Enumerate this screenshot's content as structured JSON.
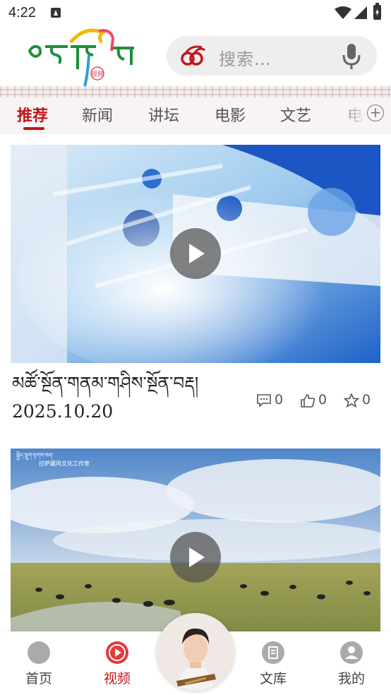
{
  "status_bar": {
    "time": "4:22"
  },
  "header": {
    "logo_alt": "西藏视频 logo",
    "logo_badge": "视频",
    "search": {
      "placeholder": "搜索…"
    }
  },
  "tabs": [
    {
      "label": "推荐",
      "active": true
    },
    {
      "label": "新闻",
      "active": false
    },
    {
      "label": "讲坛",
      "active": false
    },
    {
      "label": "电影",
      "active": false
    },
    {
      "label": "文艺",
      "active": false
    },
    {
      "label": "电",
      "active": false
    }
  ],
  "feed": [
    {
      "title": "མཚོ་སྔོན་གནམ་གཤིས་སྔོན་བརྡ། 2025.10.20",
      "comments": "0",
      "likes": "0",
      "favorites": "0"
    },
    {
      "title": "",
      "overlay_text": "拉萨藏风文化工作室"
    }
  ],
  "bottom_nav": [
    {
      "label": "首页",
      "active": false
    },
    {
      "label": "视频",
      "active": true
    },
    {
      "label": "",
      "active": false
    },
    {
      "label": "文库",
      "active": false
    },
    {
      "label": "我的",
      "active": false
    }
  ],
  "colors": {
    "accent": "#c0161d",
    "nav_inactive": "#aaaaaa",
    "search_bg": "#eeeeee"
  }
}
